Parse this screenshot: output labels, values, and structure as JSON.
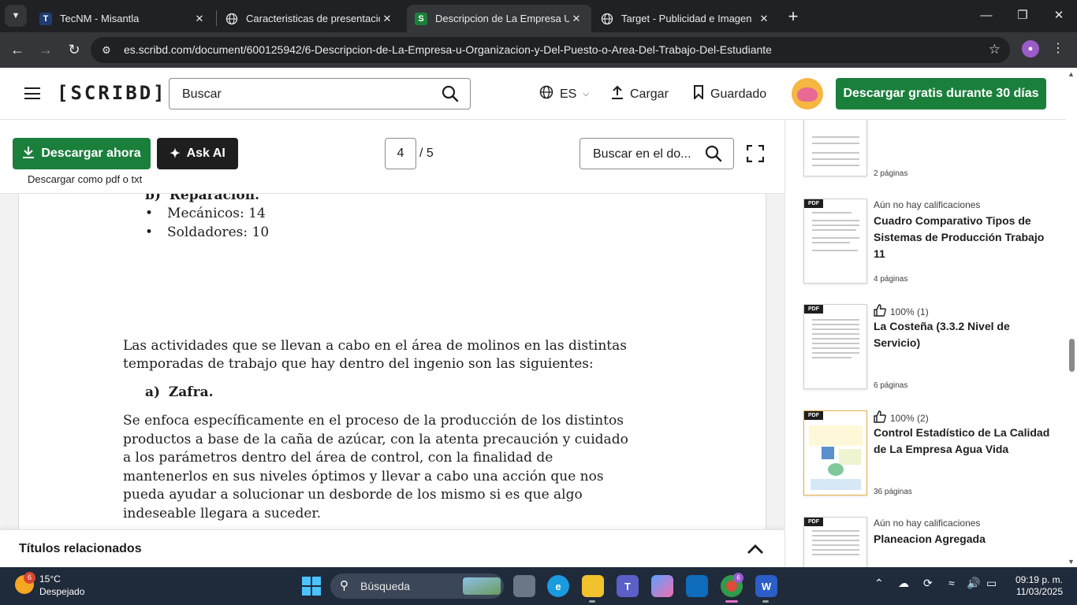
{
  "browser": {
    "tabs": [
      {
        "title": "TecNM - Misantla",
        "favicon": "tecnm-logo",
        "active": false
      },
      {
        "title": "Caracteristicas de presentacion",
        "favicon": "globe-icon",
        "active": false
      },
      {
        "title": "Descripcion de La Empresa U O",
        "favicon": "scribd-icon",
        "active": true
      },
      {
        "title": "Target - Publicidad e Imagen",
        "favicon": "globe-icon",
        "active": false
      }
    ],
    "url": "es.scribd.com/document/600125942/6-Descripcion-de-La-Empresa-u-Organizacion-y-Del-Puesto-o-Area-Del-Trabajo-Del-Estudiante"
  },
  "header": {
    "logo": "[SCRIBD]",
    "search_placeholder": "Buscar",
    "language": "ES",
    "upload": "Cargar",
    "saved": "Guardado",
    "cta": "Descargar gratis durante 30 días"
  },
  "doc_toolbar": {
    "download": "Descargar ahora",
    "download_sub": "Descargar como pdf o txt",
    "ask_ai": "Ask AI",
    "page_current": "4",
    "page_total": "/ 5",
    "search_placeholder": "Buscar en el do..."
  },
  "document": {
    "heading_b": "b)",
    "heading_b_text": "Reparación.",
    "bullets": [
      "Mecánicos: 14",
      "Soldadores: 10"
    ],
    "para1": [
      "Las actividades que se llevan a cabo en el área de molinos en las distintas",
      "temporadas de trabajo que hay dentro del ingenio son las siguientes:"
    ],
    "heading_a": "a)",
    "heading_a_text": "Zafra.",
    "para2": [
      "Se enfoca específicamente en el proceso de la producción de los distintos",
      "productos a base de la caña de azúcar, con la atenta precaución y cuidado",
      "a los parámetros dentro del área de control, con la finalidad de",
      "mantenerlos en sus niveles óptimos y llevar a cabo una acción que nos",
      "pueda ayudar a solucionar un desborde de los mismo si es que algo",
      "indeseable llegara a suceder."
    ]
  },
  "related_bar": {
    "title": "Títulos relacionados"
  },
  "sidebar": {
    "items": [
      {
        "rating": "",
        "title": "",
        "pages": "2 páginas",
        "pdf": ""
      },
      {
        "rating": "Aún no hay calificaciones",
        "title": "Cuadro Comparativo Tipos de Sistemas de Producción Trabajo 11",
        "pages": "4 páginas",
        "pdf": "PDF"
      },
      {
        "rating": "100% (1)",
        "title": "La Costeña (3.3.2 Nivel de Servicio)",
        "pages": "6 páginas",
        "pdf": "PDF"
      },
      {
        "rating": "100% (2)",
        "title": "Control Estadístico de La Calidad de La Empresa Agua Vida",
        "pages": "36 páginas",
        "pdf": "PDF"
      },
      {
        "rating": "Aún no hay calificaciones",
        "title": "Planeacion Agregada",
        "pages": "",
        "pdf": "PDF"
      }
    ]
  },
  "taskbar": {
    "weather_badge": "6",
    "temp": "15°C",
    "condition": "Despejado",
    "search_placeholder": "Búsqueda",
    "chrome_badge": "6",
    "time": "09:19 p. m.",
    "date": "11/03/2025"
  },
  "colors": {
    "brand_green": "#1b7f3c",
    "chrome_dark": "#202124",
    "chrome_toolbar": "#35363a",
    "taskbar": "#1f2a3a"
  }
}
